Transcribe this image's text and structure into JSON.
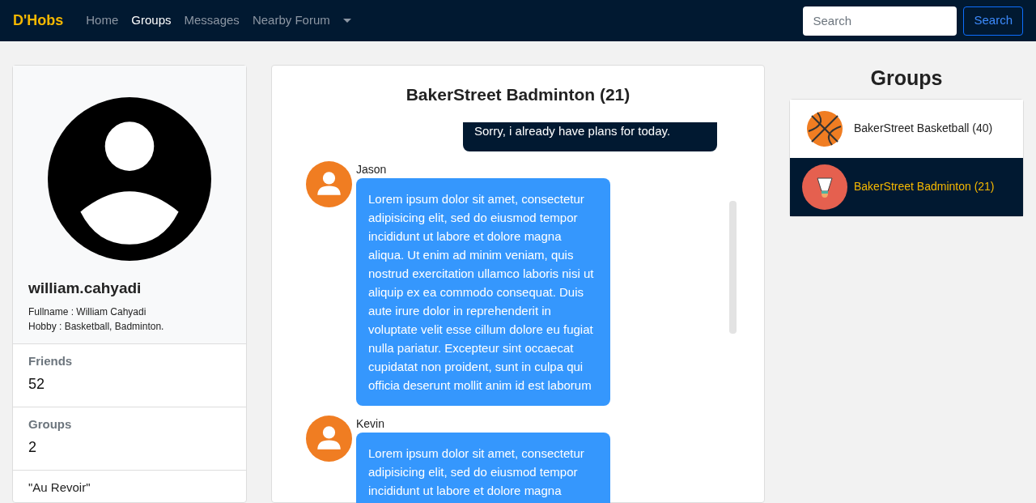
{
  "brand": "D'Hobs",
  "nav": [
    {
      "label": "Home",
      "selected": false
    },
    {
      "label": "Groups",
      "selected": true
    },
    {
      "label": "Messages",
      "selected": false
    },
    {
      "label": "Nearby Forum",
      "selected": false
    }
  ],
  "search": {
    "placeholder": "Search",
    "button": "Search"
  },
  "profile": {
    "username": "william.cahyadi",
    "fullname": "Fullname : William Cahyadi",
    "hobby": "Hobby : Basketball, Badminton.",
    "stats": [
      {
        "label": "Friends",
        "value": "52"
      },
      {
        "label": "Groups",
        "value": "2"
      }
    ],
    "quote": "\"Au Revoir\""
  },
  "chat": {
    "title": "BakerStreet Badminton (21)",
    "messages": [
      {
        "kind": "own",
        "text": "Sorry, i already have plans for today."
      },
      {
        "kind": "other",
        "sender": "Jason",
        "text": "Lorem ipsum dolor sit amet, consectetur adipisicing elit, sed do eiusmod tempor incididunt ut labore et dolore magna aliqua. Ut enim ad minim veniam, quis nostrud exercitation ullamco laboris nisi ut aliquip ex ea commodo consequat. Duis aute irure dolor in reprehenderit in voluptate velit esse cillum dolore eu fugiat nulla pariatur. Excepteur sint occaecat cupidatat non proident, sunt in culpa qui officia deserunt mollit anim id est laborum"
      },
      {
        "kind": "other",
        "sender": "Kevin",
        "text": "Lorem ipsum dolor sit amet, consectetur adipisicing elit, sed do eiusmod tempor incididunt ut labore et dolore magna"
      }
    ]
  },
  "groups": {
    "title": "Groups",
    "items": [
      {
        "kind": "basketball",
        "name": "BakerStreet Basketball (40)",
        "selected": false
      },
      {
        "kind": "badminton",
        "name": "BakerStreet Badminton (21)",
        "selected": true
      }
    ]
  }
}
